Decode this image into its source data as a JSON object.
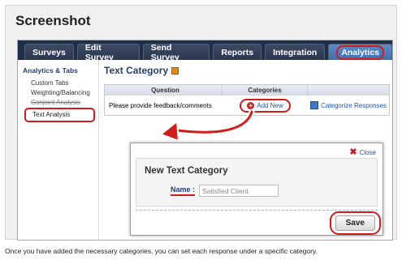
{
  "page": {
    "title": "Screenshot",
    "caption": "Once you have added the necessary categories, you can set each response under a specific category."
  },
  "nav": {
    "tabs": [
      "Surveys",
      "Edit Survey",
      "Send Survey",
      "Reports",
      "Integration",
      "Analytics"
    ],
    "active_tab": "Analytics"
  },
  "sidebar": {
    "title": "Analytics & Tabs",
    "items": [
      "Custom Tabs",
      "Weighting/Balancing",
      "Conjoint Analysis"
    ],
    "highlighted_item": "Text Analysis"
  },
  "content": {
    "title": "Text Category",
    "table": {
      "headers": [
        "Question",
        "Categories",
        ""
      ],
      "row": {
        "question": "Please provide feedback/comments",
        "add_label": "Add New",
        "categorize_label": "Categorize Responses"
      }
    }
  },
  "modal": {
    "close_label": "Close",
    "title": "New Text Category",
    "name_label": "Name :",
    "name_value": "Satisfied Client",
    "save_label": "Save"
  },
  "icons": [
    "edit-icon",
    "plus-icon",
    "categorize-icon",
    "close-x-icon",
    "curved-arrow-icon"
  ],
  "colors": {
    "nav_bg": "#1f2f47",
    "active_tab": "#4a7cbd",
    "annotation_red": "#d21c1c",
    "link_blue": "#1f4f9a"
  }
}
